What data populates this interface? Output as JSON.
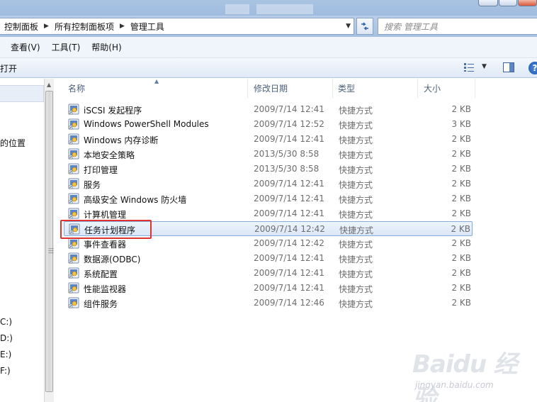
{
  "address": {
    "crumbs": [
      "控制面板",
      "所有控制面板项",
      "管理工具"
    ],
    "search_placeholder": "搜索 管理工具"
  },
  "menu": [
    "查看(V)",
    "工具(T)",
    "帮助(H)"
  ],
  "toolbar": {
    "open_label": "打开"
  },
  "nav": {
    "items": [
      "的位置",
      "C:)",
      "D:)",
      "E:)",
      "F:)"
    ]
  },
  "columns": {
    "name": "名称",
    "date": "修改日期",
    "type": "类型",
    "size": "大小"
  },
  "files": [
    {
      "name": "iSCSI 发起程序",
      "date": "2009/7/14 12:41",
      "type": "快捷方式",
      "size": "2 KB"
    },
    {
      "name": "Windows PowerShell Modules",
      "date": "2009/7/14 12:52",
      "type": "快捷方式",
      "size": "3 KB"
    },
    {
      "name": "Windows 内存诊断",
      "date": "2009/7/14 12:41",
      "type": "快捷方式",
      "size": "2 KB"
    },
    {
      "name": "本地安全策略",
      "date": "2013/5/30 8:58",
      "type": "快捷方式",
      "size": "2 KB"
    },
    {
      "name": "打印管理",
      "date": "2013/5/30 8:58",
      "type": "快捷方式",
      "size": "2 KB"
    },
    {
      "name": "服务",
      "date": "2009/7/14 12:41",
      "type": "快捷方式",
      "size": "2 KB"
    },
    {
      "name": "高级安全 Windows 防火墙",
      "date": "2009/7/14 12:41",
      "type": "快捷方式",
      "size": "2 KB"
    },
    {
      "name": "计算机管理",
      "date": "2009/7/14 12:41",
      "type": "快捷方式",
      "size": "2 KB"
    },
    {
      "name": "任务计划程序",
      "date": "2009/7/14 12:42",
      "type": "快捷方式",
      "size": "2 KB"
    },
    {
      "name": "事件查看器",
      "date": "2009/7/14 12:42",
      "type": "快捷方式",
      "size": "2 KB"
    },
    {
      "name": "数据源(ODBC)",
      "date": "2009/7/14 12:41",
      "type": "快捷方式",
      "size": "2 KB"
    },
    {
      "name": "系统配置",
      "date": "2009/7/14 12:41",
      "type": "快捷方式",
      "size": "2 KB"
    },
    {
      "name": "性能监视器",
      "date": "2009/7/14 12:41",
      "type": "快捷方式",
      "size": "2 KB"
    },
    {
      "name": "组件服务",
      "date": "2009/7/14 12:46",
      "type": "快捷方式",
      "size": "2 KB"
    }
  ],
  "selected_index": 8,
  "icons": [
    "refresh-icon",
    "view-options-icon",
    "preview-pane-icon",
    "help-icon",
    "shortcut-tool-icon"
  ],
  "colors": {
    "highlight_box": "#e0322f",
    "selection_border": "#84acdd",
    "header_text": "#4c607a"
  },
  "watermark": {
    "brand": "Baidu 经验",
    "sub": "jingyan.baidu.com"
  }
}
